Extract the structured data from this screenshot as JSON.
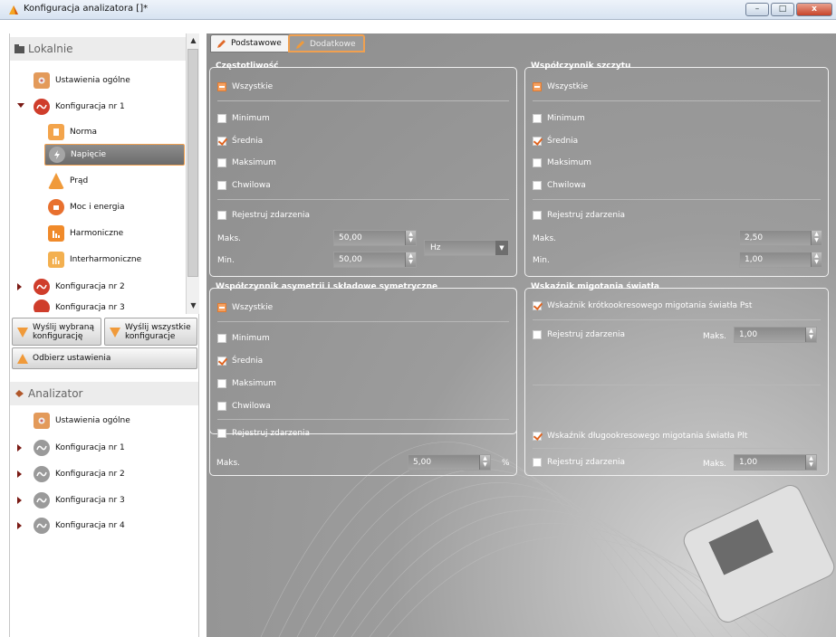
{
  "window": {
    "title": "Konfiguracja analizatora []*",
    "buttons": [
      "–",
      "□",
      "x"
    ]
  },
  "local": {
    "header": "Lokalnie",
    "items": [
      {
        "label": "Ustawienia ogólne"
      },
      {
        "label": "Konfiguracja nr 1"
      },
      {
        "label": "Norma"
      },
      {
        "label": "Napięcie"
      },
      {
        "label": "Prąd"
      },
      {
        "label": "Moc i energia"
      },
      {
        "label": "Harmoniczne"
      },
      {
        "label": "Interharmoniczne"
      },
      {
        "label": "Konfiguracja nr 2"
      },
      {
        "label": "Konfiguracja nr 3"
      }
    ]
  },
  "actions": {
    "send_selected": "Wyślij wybraną konfigurację",
    "send_all": "Wyślij wszystkie konfiguracje",
    "receive": "Odbierz ustawienia"
  },
  "analyzer": {
    "header": "Analizator",
    "items": [
      {
        "label": "Ustawienia ogólne"
      },
      {
        "label": "Konfiguracja nr 1"
      },
      {
        "label": "Konfiguracja nr 2"
      },
      {
        "label": "Konfiguracja nr 3"
      },
      {
        "label": "Konfiguracja nr 4"
      }
    ]
  },
  "tabs": {
    "basic": "Podstawowe",
    "additional": "Dodatkowe"
  },
  "freq": {
    "title": "Częstotliwość",
    "all": "Wszystkie",
    "min": "Minimum",
    "avg": "Średnia",
    "max": "Maksimum",
    "inst": "Chwilowa",
    "events": "Rejestruj zdarzenia",
    "max_label": "Maks.",
    "max_value": "50,00",
    "min_label": "Min.",
    "min_value": "50,00",
    "unit": "Hz"
  },
  "crest": {
    "title": "Współczynnik szczytu",
    "all": "Wszystkie",
    "min": "Minimum",
    "avg": "Średnia",
    "max": "Maksimum",
    "inst": "Chwilowa",
    "events": "Rejestruj zdarzenia",
    "max_label": "Maks.",
    "max_value": "2,50",
    "min_label": "Min.",
    "min_value": "1,00"
  },
  "asym": {
    "title": "Współczynnik asymetrii i składowe symetryczne",
    "all": "Wszystkie",
    "min": "Minimum",
    "avg": "Średnia",
    "max": "Maksimum",
    "inst": "Chwilowa",
    "events": "Rejestruj zdarzenia",
    "max_label": "Maks.",
    "max_value": "5,00",
    "unit": "%"
  },
  "flicker": {
    "title": "Wskaźnik migotania światła",
    "pst": "Wskaźnik krótkookresowego migotania światła Pst",
    "pst_events": "Rejestruj zdarzenia",
    "pst_max_label": "Maks.",
    "pst_max_value": "1,00",
    "plt": "Wskaźnik długookresowego migotania światła Plt",
    "plt_events": "Rejestruj zdarzenia",
    "plt_max_label": "Maks.",
    "plt_max_value": "1,00"
  },
  "colors": {
    "accent": "#f0a050",
    "panel": "#969696",
    "selected": "#7a7a7a"
  }
}
